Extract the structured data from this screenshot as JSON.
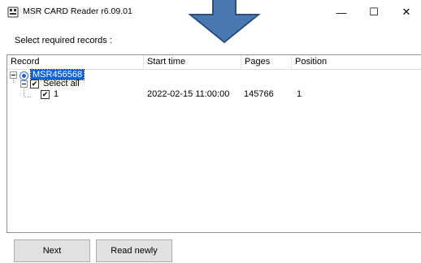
{
  "window": {
    "title": "MSR CARD Reader r6.09.01",
    "minimize_glyph": "—",
    "maximize_glyph": "☐",
    "close_glyph": "✕"
  },
  "prompt": "Select required records :",
  "list": {
    "columns": [
      "Record",
      "Start time",
      "Pages",
      "Position"
    ],
    "root_label": "MSR456568",
    "select_all_label": "Select all",
    "rows": [
      {
        "record": "1",
        "start_time": "2022-02-15 11:00:00",
        "pages": "145766",
        "position": "1"
      }
    ]
  },
  "buttons": {
    "next": "Next",
    "read_newly": "Read newly"
  },
  "colors": {
    "selection": "#0a64d8",
    "arrow_fill": "#4a78b0",
    "arrow_stroke": "#2d4f7a"
  },
  "icons": {
    "app": "card-reader-icon",
    "arrow": "down-arrow-icon"
  }
}
